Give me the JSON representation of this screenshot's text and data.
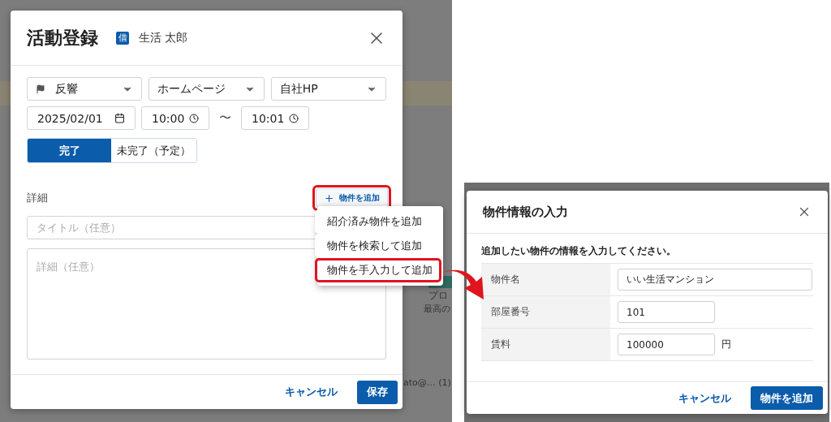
{
  "background_texts": [
    {
      "label": "プロ",
      "kind": "title"
    },
    {
      "label": "最高の",
      "kind": "caption"
    },
    {
      "label": "ato@… (1)",
      "kind": "email"
    }
  ],
  "activity_dialog": {
    "title": "活動登録",
    "customer_badge": "借",
    "customer_name": "生活 太郎",
    "selects": [
      {
        "label": "反響",
        "kind": "flagged"
      },
      {
        "label": "ホームページ",
        "kind": "plain"
      },
      {
        "label": "自社HP",
        "kind": "plain"
      }
    ],
    "date": "2025/02/01",
    "start_time": "10:00",
    "separator": "〜",
    "end_time": "10:01",
    "status_toggle": [
      {
        "label": "完了",
        "selected": true
      },
      {
        "label": "未完了（予定）",
        "selected": false
      }
    ],
    "detail_label": "詳細",
    "add_property_button": {
      "label": "物件を追加",
      "highlighted": true
    },
    "title_placeholder": "タイトル（任意）",
    "detail_placeholder": "詳細（任意）",
    "cancel_button": "キャンセル",
    "save_button": "保存"
  },
  "property_menu": {
    "items": [
      {
        "label": "紹介済み物件を追加",
        "highlighted": false
      },
      {
        "label": "物件を検索して追加",
        "highlighted": false
      },
      {
        "label": "物件を手入力して追加",
        "highlighted": true
      }
    ]
  },
  "property_dialog": {
    "title": "物件情報の入力",
    "instruction": "追加したい物件の情報を入力してください。",
    "rows": [
      {
        "label": "物件名",
        "value": "いい生活マンション",
        "kind": "wide"
      },
      {
        "label": "部屋番号",
        "value": "101",
        "kind": "short"
      },
      {
        "label": "賃料",
        "value": "100000",
        "kind": "short",
        "unit": "円"
      }
    ],
    "cancel_button": "キャンセル",
    "submit_button": "物件を追加"
  }
}
